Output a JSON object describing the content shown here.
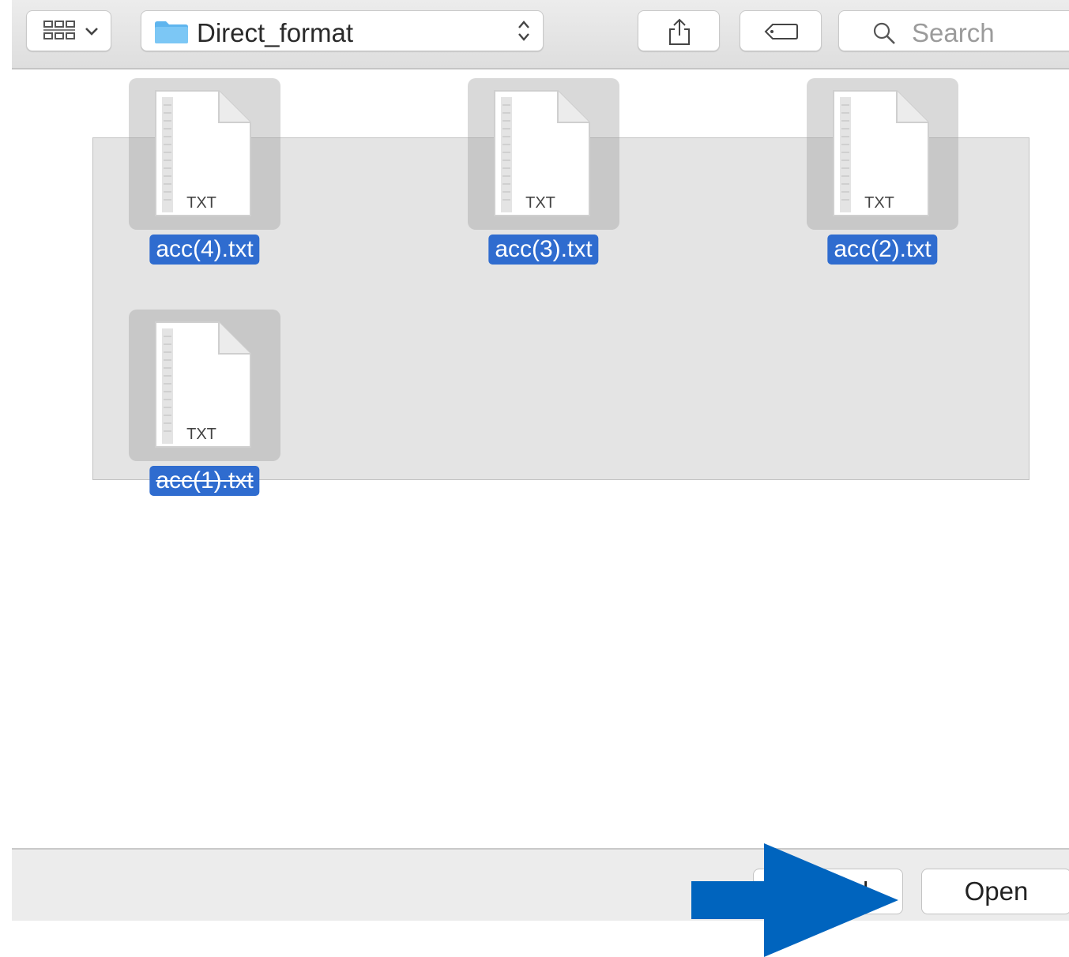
{
  "toolbar": {
    "path_popup": {
      "label": "Direct_format",
      "icon": "folder-icon"
    },
    "view_button": {
      "icon": "icon-grid-icon"
    },
    "share_button": {
      "icon": "share-icon"
    },
    "tag_button": {
      "icon": "tag-icon"
    },
    "search": {
      "placeholder": "Search",
      "icon": "magnifier-icon"
    }
  },
  "files": [
    {
      "name": "acc(4).txt",
      "badge": "TXT",
      "selected": true
    },
    {
      "name": "acc(3).txt",
      "badge": "TXT",
      "selected": true
    },
    {
      "name": "acc(2).txt",
      "badge": "TXT",
      "selected": true
    },
    {
      "name": "acc(1).txt",
      "badge": "TXT",
      "selected": true
    }
  ],
  "footer": {
    "cancel_label": "Cancel",
    "open_label": "Open"
  },
  "colors": {
    "selection": "#2f6ccf",
    "annotation_arrow": "#0064be",
    "folder": "#5fb5ee"
  }
}
